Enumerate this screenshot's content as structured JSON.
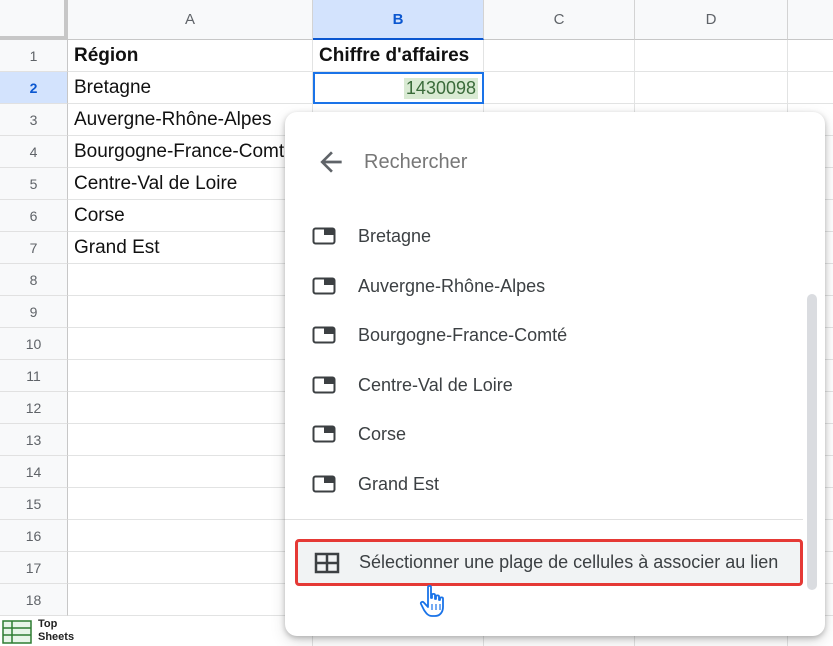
{
  "columns": [
    "A",
    "B",
    "C",
    "D"
  ],
  "selected_column": "B",
  "rows": [
    "1",
    "2",
    "3",
    "4",
    "5",
    "6",
    "7",
    "8",
    "9",
    "10",
    "11",
    "12",
    "13",
    "14",
    "15",
    "16",
    "17",
    "18"
  ],
  "selected_row": "2",
  "cells": {
    "A1": "Région",
    "B1": "Chiffre d'affaires",
    "A2": "Bretagne",
    "B2": "1430098",
    "A3": "Auvergne-Rhône-Alpes",
    "A4": "Bourgogne-France-Comté",
    "A5": "Centre-Val de Loire",
    "A6": "Corse",
    "A7": "Grand Est"
  },
  "link_popup": {
    "search_placeholder": "Rechercher",
    "sheets": [
      "Bretagne",
      "Auvergne-Rhône-Alpes",
      "Bourgogne-France-Comté",
      "Centre-Val de Loire",
      "Corse",
      "Grand Est"
    ],
    "range_option": "Sélectionner une plage de cellules à associer au lien",
    "highlight_color": "#e53935"
  },
  "watermark": {
    "line1": "Top",
    "line2": "Sheets"
  },
  "icons": {
    "back": "arrow-left-icon",
    "sheet": "sheet-tab-icon",
    "range": "grid-table-icon",
    "cursor": "hand-pointer-icon"
  }
}
